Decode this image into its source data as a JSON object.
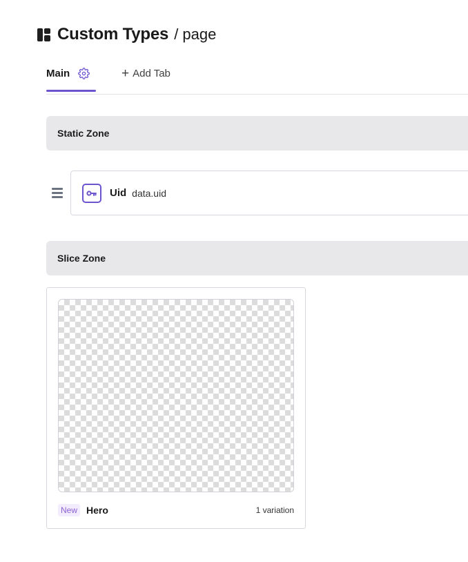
{
  "header": {
    "title": "Custom Types",
    "subpath": "/ page",
    "logo_icon": "layout-icon"
  },
  "tabs": {
    "items": [
      {
        "label": "Main",
        "active": true,
        "settings_icon": "gear-icon"
      }
    ],
    "add_tab_label": "Add Tab",
    "add_tab_icon": "plus-icon",
    "accent_color": "#6d54cf"
  },
  "static_zone": {
    "label": "Static Zone",
    "fields": [
      {
        "name": "Uid",
        "path": "data.uid",
        "icon": "key-icon"
      }
    ]
  },
  "slice_zone": {
    "label": "Slice Zone",
    "slices": [
      {
        "badge": "New",
        "name": "Hero",
        "variations": "1 variation"
      }
    ]
  }
}
